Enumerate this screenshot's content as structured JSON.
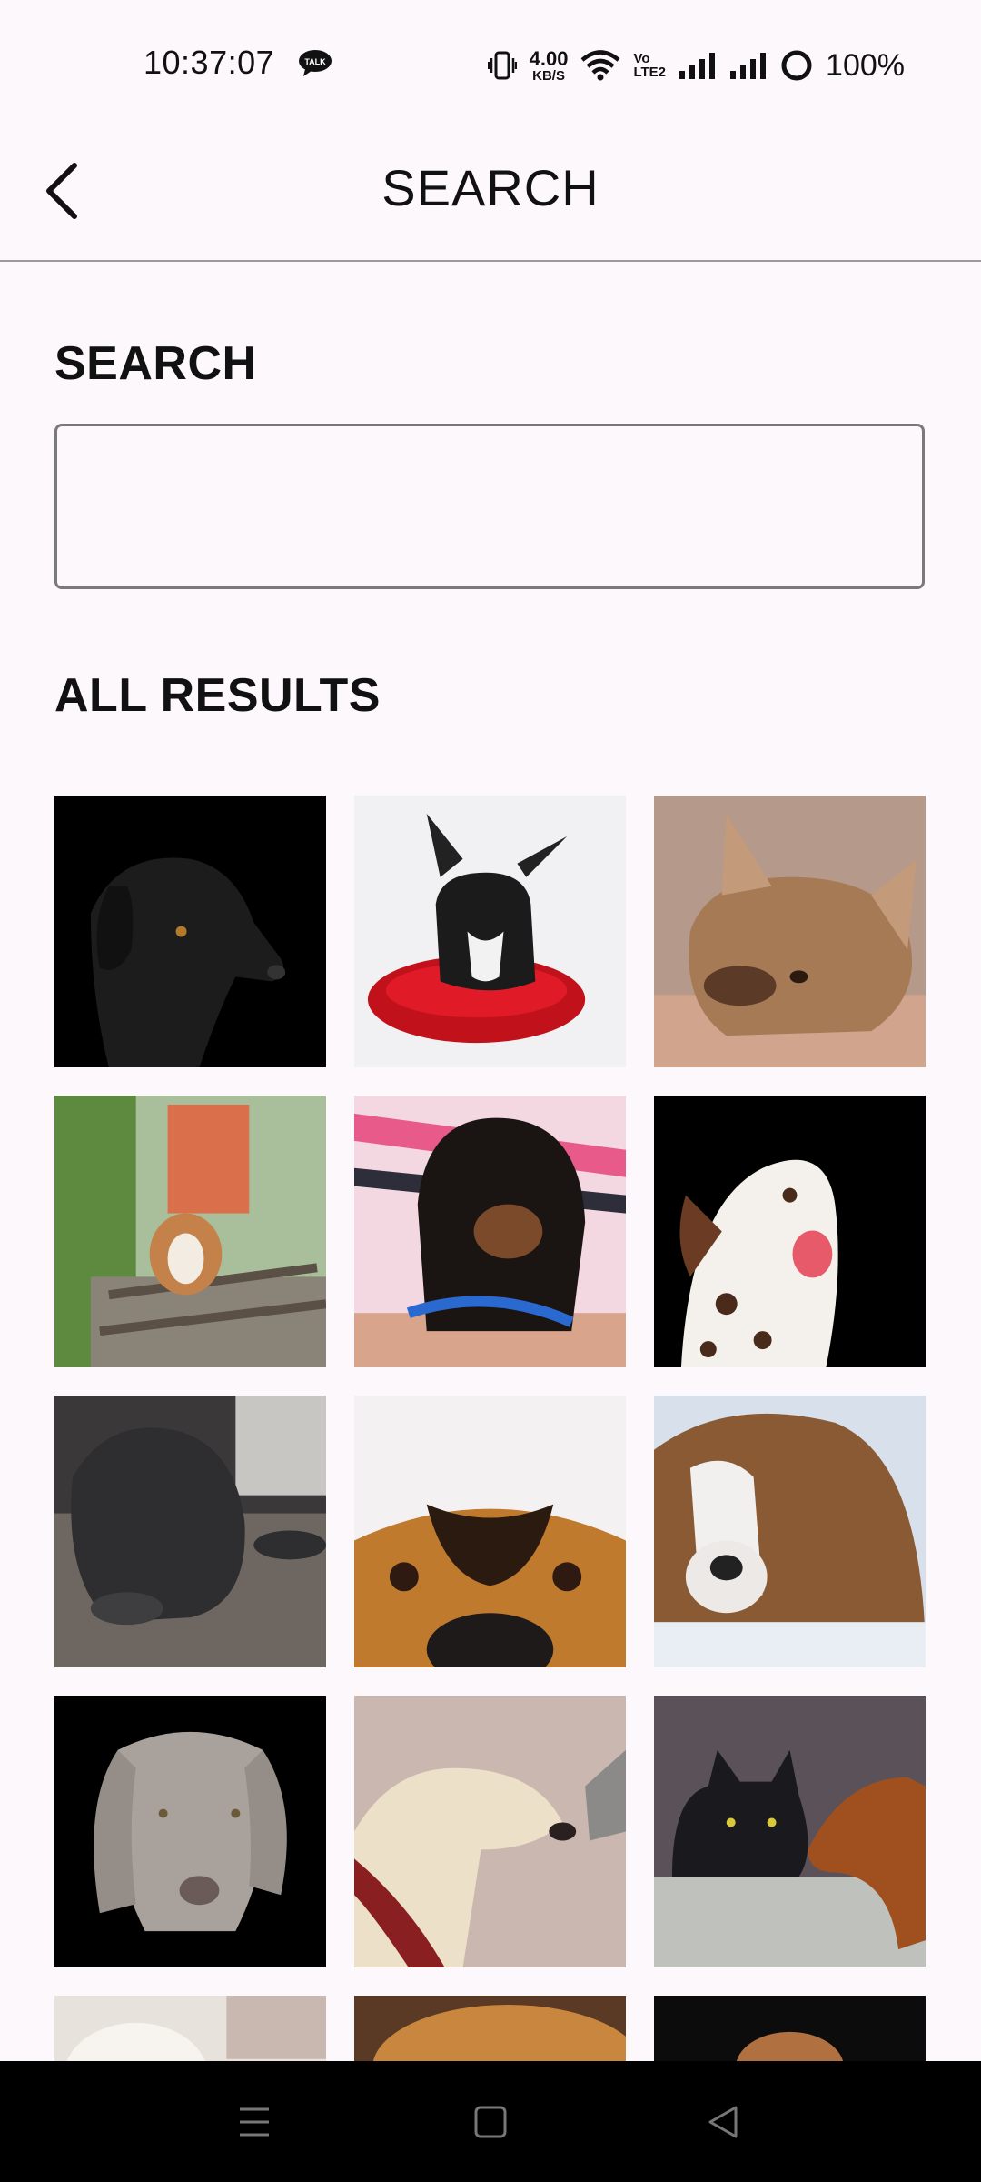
{
  "status_bar": {
    "time": "10:37:07",
    "net_speed_value": "4.00",
    "net_speed_unit": "KB/S",
    "volte_top": "Vo",
    "volte_bottom": "LTE2",
    "battery": "100%"
  },
  "app_bar": {
    "title": "SEARCH",
    "back_icon": "chevron-left-icon"
  },
  "search_section": {
    "heading": "SEARCH",
    "input_value": "",
    "input_placeholder": ""
  },
  "results_section": {
    "heading": "ALL RESULTS",
    "results": [
      {
        "subject": "black dog profile on black background"
      },
      {
        "subject": "black french bulldog puppy on red cushion"
      },
      {
        "subject": "fawn french bulldog lying down"
      },
      {
        "subject": "corgi walking on railway track"
      },
      {
        "subject": "dachshund puppy in arms"
      },
      {
        "subject": "dalmatian licking nose"
      },
      {
        "subject": "grey puppy lying on wooden floor"
      },
      {
        "subject": "close-up of dog eyes and nose"
      },
      {
        "subject": "saint bernard in snow"
      },
      {
        "subject": "weimaraner portrait"
      },
      {
        "subject": "golden retriever with red collar"
      },
      {
        "subject": "black cat and spaniel"
      },
      {
        "subject": "white fluffy dog"
      },
      {
        "subject": "brown dog"
      },
      {
        "subject": "brown dog on black background"
      }
    ]
  },
  "nav_bar": {
    "recents_icon": "menu-icon",
    "home_icon": "square-icon",
    "back_icon": "triangle-back-icon"
  }
}
